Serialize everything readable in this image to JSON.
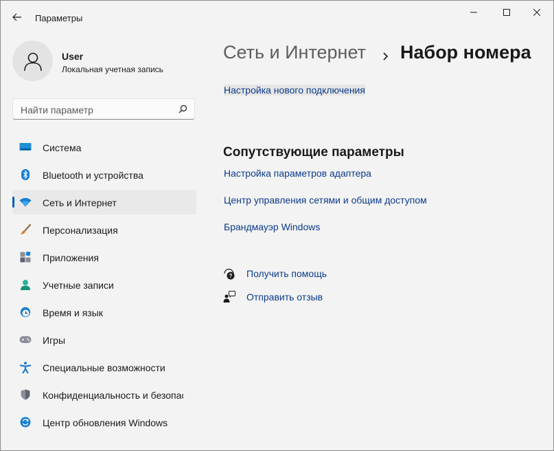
{
  "window": {
    "title": "Параметры",
    "controls": {
      "minimize": "minimize-icon",
      "maximize": "maximize-icon",
      "close": "close-icon"
    }
  },
  "profile": {
    "name": "User",
    "account_type": "Локальная учетная запись"
  },
  "search": {
    "placeholder": "Найти параметр"
  },
  "sidebar": {
    "items": [
      {
        "label": "Система",
        "icon": "system-icon"
      },
      {
        "label": "Bluetooth и устройства",
        "icon": "bluetooth-icon"
      },
      {
        "label": "Сеть и Интернет",
        "icon": "wifi-icon",
        "active": true
      },
      {
        "label": "Персонализация",
        "icon": "brush-icon"
      },
      {
        "label": "Приложения",
        "icon": "apps-icon"
      },
      {
        "label": "Учетные записи",
        "icon": "accounts-icon"
      },
      {
        "label": "Время и язык",
        "icon": "time-language-icon"
      },
      {
        "label": "Игры",
        "icon": "gamepad-icon"
      },
      {
        "label": "Специальные возможности",
        "icon": "accessibility-icon"
      },
      {
        "label": "Конфиденциальность и безопасность",
        "icon": "shield-icon"
      },
      {
        "label": "Центр обновления Windows",
        "icon": "update-icon"
      }
    ]
  },
  "main": {
    "breadcrumb": {
      "parent": "Сеть и Интернет",
      "separator": "›",
      "current": "Набор номера"
    },
    "setup_link": "Настройка нового подключения",
    "related_title": "Сопутствующие параметры",
    "related_links": [
      "Настройка параметров адаптера",
      "Центр управления сетями и общим доступом",
      "Брандмауэр Windows"
    ],
    "help": {
      "get_help": "Получить помощь",
      "feedback": "Отправить отзыв"
    }
  },
  "colors": {
    "accent": "#005fb8",
    "link": "#0a3a8a",
    "background": "#f3f3f3",
    "active_item": "#e9e9e9"
  }
}
